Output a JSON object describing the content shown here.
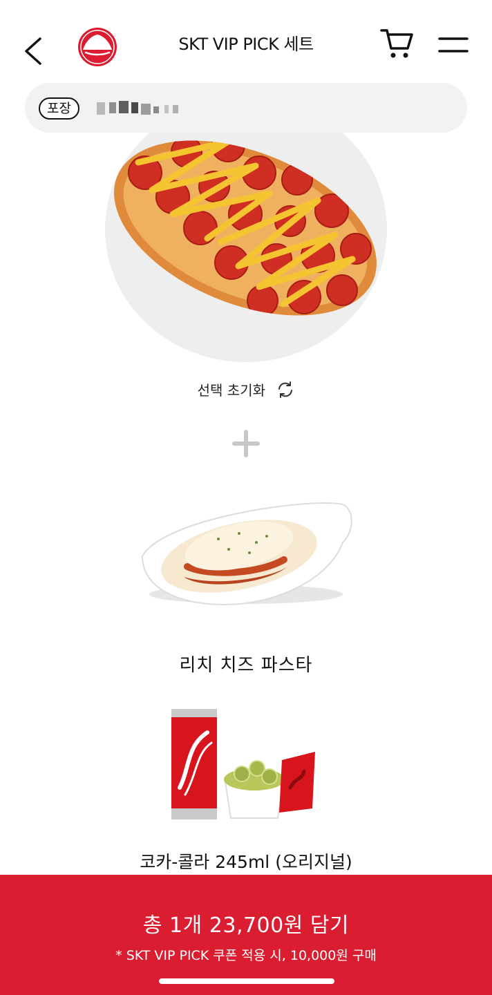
{
  "header": {
    "title": "SKT VIP PICK 세트",
    "icons": {
      "back": "chevron-left-icon",
      "logo": "pizza-hut-logo",
      "cart": "cart-icon",
      "menu": "hamburger-menu-icon"
    }
  },
  "address_bar": {
    "mode_label": "포장",
    "address_masked": true
  },
  "pizza": {
    "reset_label": "선택 초기화",
    "reset_icon": "refresh-icon"
  },
  "items": {
    "pasta": "리치 치즈 파스타",
    "drink": "코카-콜라 245ml (오리지널)"
  },
  "cta": {
    "main_label": "총 1개 23,700원 담기",
    "sub_label": "* SKT VIP PICK 쿠폰 적용 시, 10,000원 구매"
  },
  "colors": {
    "brand_red": "#da1d31",
    "address_bg": "#f2f2f2",
    "plate_bg": "#eeeeee"
  }
}
